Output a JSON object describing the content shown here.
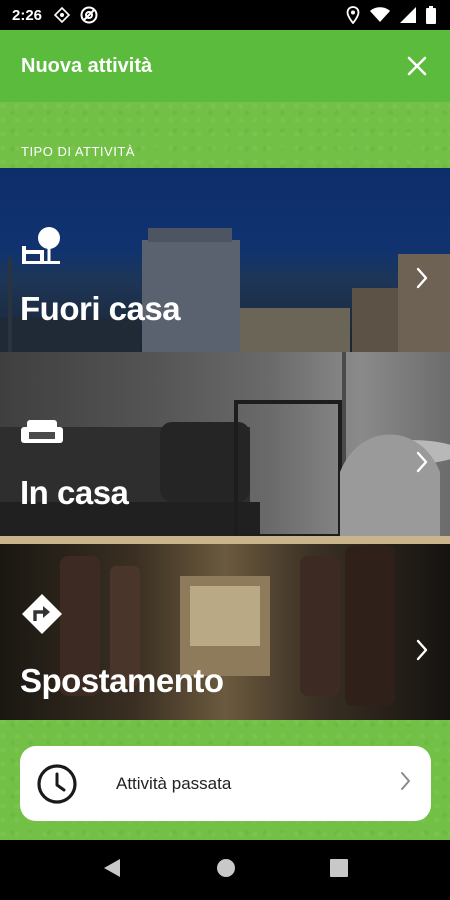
{
  "status_bar": {
    "time": "2:26",
    "left_icons": [
      "compass-icon",
      "app-notification-icon"
    ],
    "right_icons": [
      "location-icon",
      "wifi-icon",
      "signal-icon",
      "battery-icon"
    ]
  },
  "app_bar": {
    "title": "Nuova attività",
    "close_icon": "close-icon"
  },
  "section": {
    "label": "TIPO DI ATTIVITÀ"
  },
  "cards": [
    {
      "label": "Fuori casa",
      "icon": "tree-bench-icon"
    },
    {
      "label": "In casa",
      "icon": "sofa-icon"
    },
    {
      "label": "Spostamento",
      "icon": "direction-sign-icon"
    }
  ],
  "past_activity": {
    "label": "Attività passata",
    "icon": "clock-icon"
  },
  "nav": {
    "icons": [
      "back-icon",
      "home-icon",
      "recents-icon"
    ]
  },
  "colors": {
    "app_bar": "#5bbb3c",
    "content_bg": "#73c047",
    "button_bg": "#ffffff"
  }
}
